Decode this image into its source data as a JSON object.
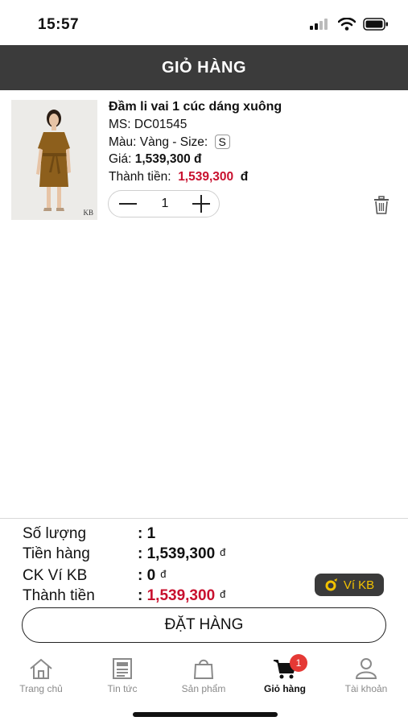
{
  "status_bar": {
    "time": "15:57"
  },
  "header": {
    "title": "GIỎ HÀNG"
  },
  "cart_item": {
    "name": "Đầm li vai 1 cúc dáng xuông",
    "code_label": "MS:",
    "code": "DC01545",
    "color_label": "Màu:",
    "color": "Vàng",
    "size_label": "- Size:",
    "size": "S",
    "price_label": "Giá:",
    "price": "1,539,300 đ",
    "total_label": "Thành tiền:",
    "total": "1,539,300",
    "currency": "đ",
    "quantity": "1",
    "image_mark": "KB"
  },
  "summary": {
    "quantity_label": "Số lượng",
    "quantity_value": ": 1",
    "subtotal_label": "Tiền hàng",
    "subtotal_value": ": 1,539,300",
    "discount_label": "CK Ví KB",
    "discount_value": ": 0",
    "total_label": "Thành tiền",
    "total_prefix": ": ",
    "total_value": "1,539,300",
    "currency": "đ",
    "wallet_button": "Ví KB",
    "order_button": "ĐẶT HÀNG"
  },
  "tabs": [
    {
      "label": "Trang chủ",
      "icon": "home-icon"
    },
    {
      "label": "Tin tức",
      "icon": "newspaper-icon"
    },
    {
      "label": "Sản phẩm",
      "icon": "shopping-bag-icon"
    },
    {
      "label": "Giỏ hàng",
      "icon": "cart-icon",
      "active": true,
      "badge": "1"
    },
    {
      "label": "Tài khoản",
      "icon": "user-icon"
    }
  ],
  "colors": {
    "header_bg": "#3b3b3b",
    "price_red": "#c8102e",
    "badge_red": "#e53935",
    "wallet_yellow": "#f2c200"
  }
}
